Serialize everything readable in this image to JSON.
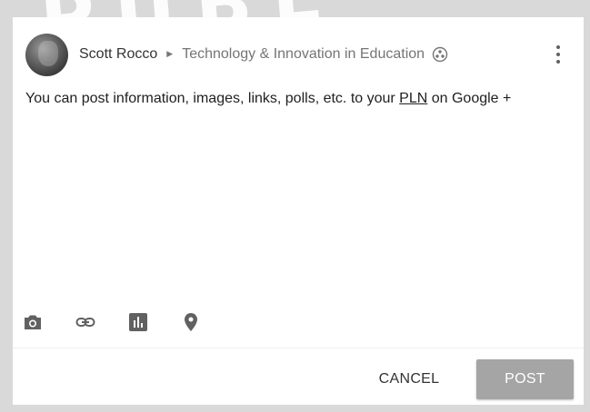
{
  "watermark": "PUBL",
  "post": {
    "author": "Scott Rocco",
    "community": "Technology & Innovation in Education",
    "body": {
      "before_link": "You can post information, images, links, polls, etc. to your ",
      "link": "PLN",
      "after_link": " on Google +"
    }
  },
  "actions": {
    "cancel_label": "CANCEL",
    "post_label": "POST"
  },
  "icons": {
    "more": "more-vert-icon",
    "community": "circles-icon",
    "attach": [
      "camera-icon",
      "link-icon",
      "poll-icon",
      "location-icon"
    ]
  },
  "colors": {
    "background": "#d9d9d9",
    "card": "#ffffff",
    "text": "#212121",
    "muted": "#757575",
    "post_button": "#a5a5a5",
    "icon": "#616161"
  }
}
